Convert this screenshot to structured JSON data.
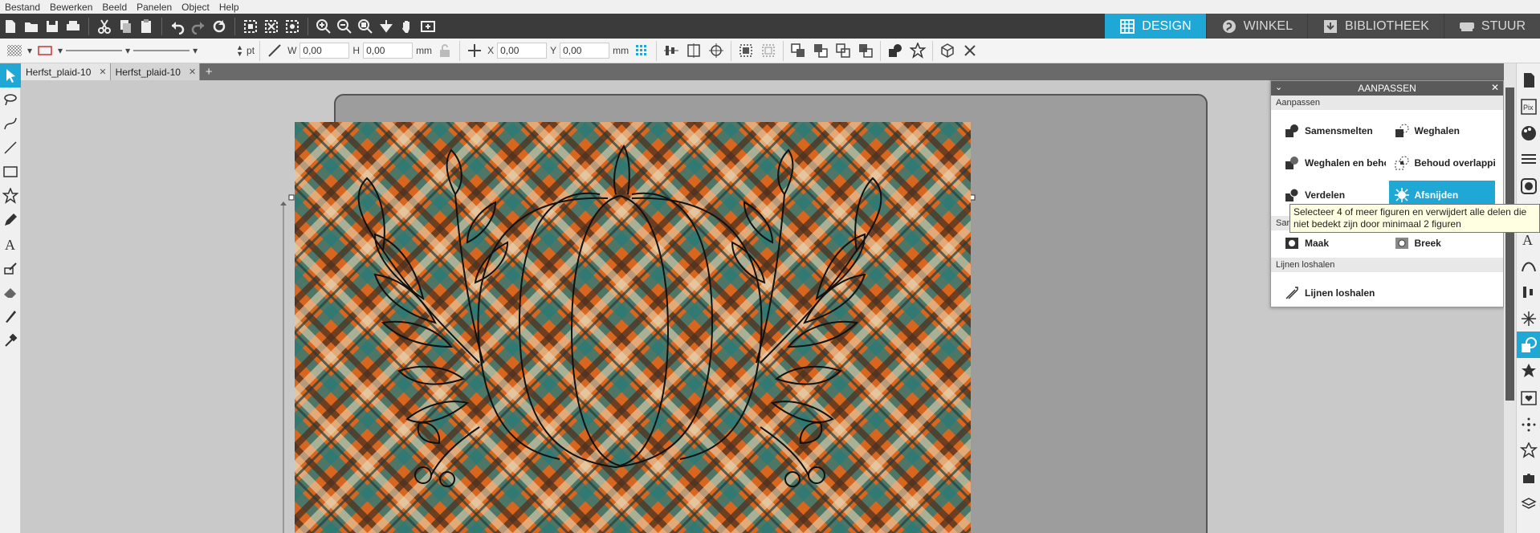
{
  "menubar": {
    "items": [
      "Bestand",
      "Bewerken",
      "Beeld",
      "Panelen",
      "Object",
      "Help"
    ]
  },
  "mode_tabs": [
    {
      "label": "DESIGN",
      "icon": "grid-icon",
      "active": true
    },
    {
      "label": "WINKEL",
      "icon": "store-icon",
      "active": false
    },
    {
      "label": "BIBLIOTHEEK",
      "icon": "download-icon",
      "active": false
    },
    {
      "label": "STUUR",
      "icon": "cutter-icon",
      "active": false
    }
  ],
  "toolbar2": {
    "stroke_unit": "pt",
    "w_label": "W",
    "w_value": "0,00",
    "h_label": "H",
    "h_value": "0,00",
    "size_unit": "mm",
    "x_label": "X",
    "x_value": "0,00",
    "y_label": "Y",
    "y_value": "0,00",
    "pos_unit": "mm"
  },
  "doc_tabs": [
    {
      "label": "Herfst_plaid-10",
      "active": true
    },
    {
      "label": "Herfst_plaid-10",
      "active": false
    }
  ],
  "panel": {
    "title": "AANPASSEN",
    "sections": [
      {
        "title": "Aanpassen",
        "buttons": [
          "Samensmelten",
          "Weghalen",
          "Weghalen en beho",
          "Behoud overlappin",
          "Verdelen",
          "Afsnijden"
        ]
      },
      {
        "title": "Sam",
        "buttons": [
          "Maak",
          "Breek"
        ]
      },
      {
        "title": "Lijnen loshalen",
        "buttons": [
          "Lijnen loshalen"
        ]
      }
    ],
    "active_button": "Afsnijden"
  },
  "tooltip": {
    "text": "Selecteer 4 of meer figuren en verwijdert alle delen die niet bedekt zijn door minimaal 2 figuren"
  },
  "colors": {
    "accent": "#1fa8d6",
    "dark_bar": "#3b3b3b",
    "plaid_orange": "#d9661f",
    "plaid_teal": "#2b7b78",
    "plaid_brown": "#4a3020",
    "plaid_cream": "#e8d7b5"
  }
}
